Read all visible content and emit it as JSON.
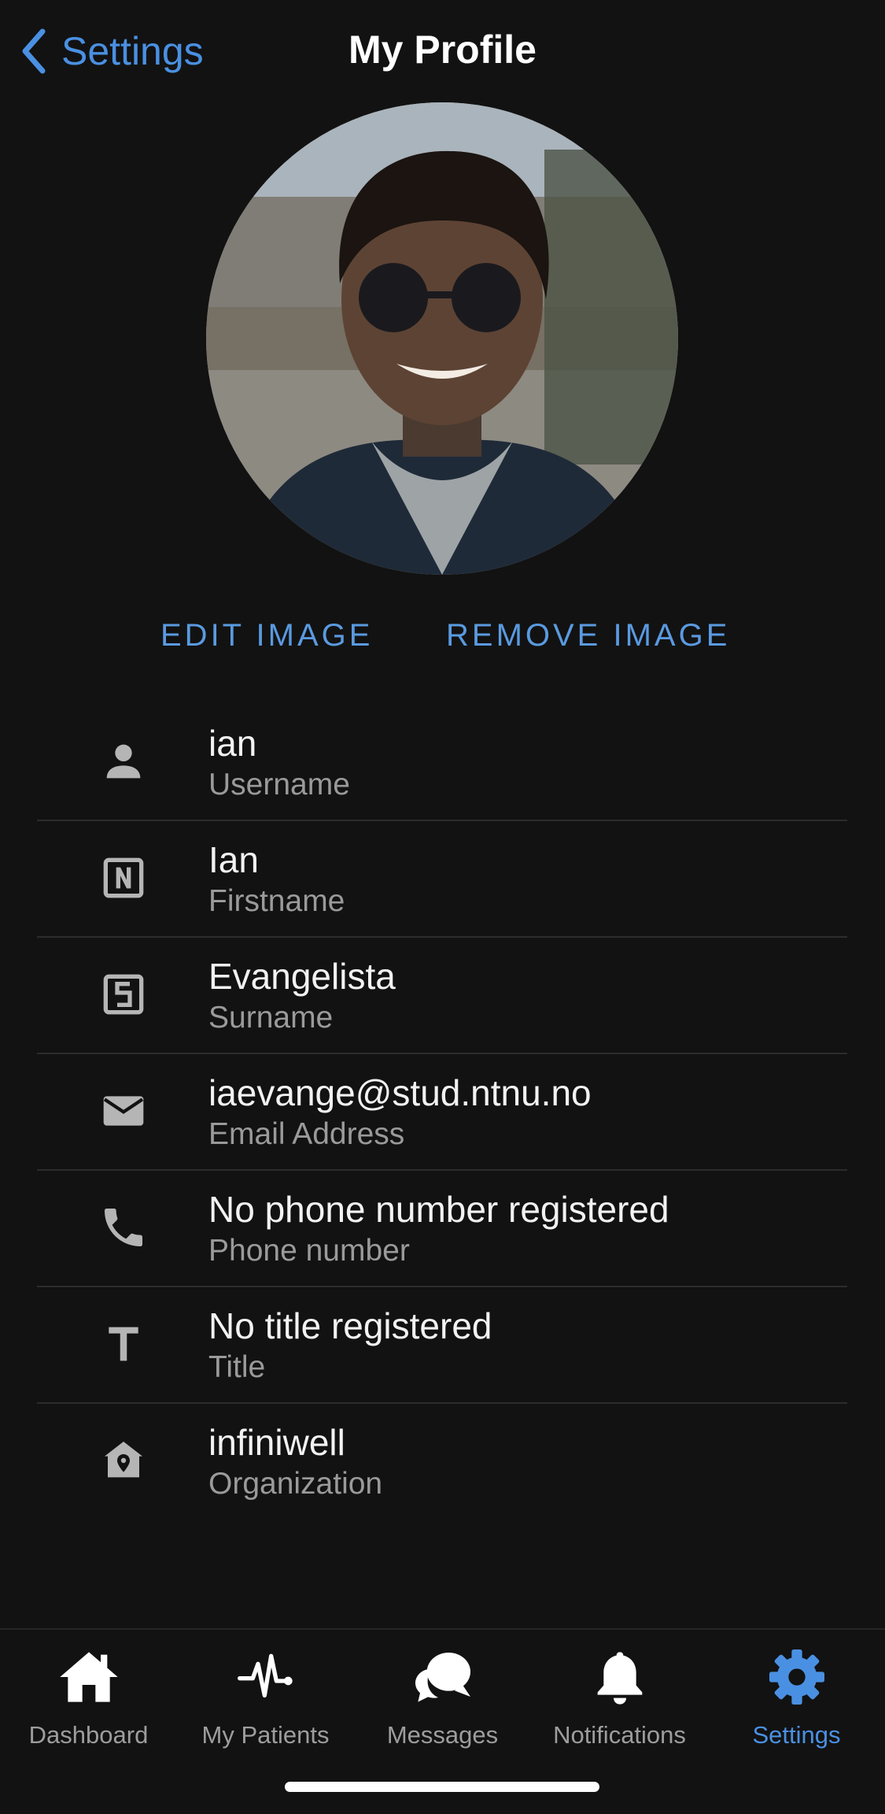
{
  "nav": {
    "back_label": "Settings",
    "title": "My Profile"
  },
  "image_actions": {
    "edit": "EDIT IMAGE",
    "remove": "REMOVE IMAGE"
  },
  "profile": [
    {
      "icon": "person-icon",
      "value": "ian",
      "label": "Username"
    },
    {
      "icon": "firstname-n-icon",
      "value": "Ian",
      "label": "Firstname"
    },
    {
      "icon": "surname-s-icon",
      "value": "Evangelista",
      "label": "Surname"
    },
    {
      "icon": "email-icon",
      "value": "iaevange@stud.ntnu.no",
      "label": "Email Address"
    },
    {
      "icon": "phone-icon",
      "value": "No phone number registered",
      "label": "Phone number"
    },
    {
      "icon": "title-t-icon",
      "value": "No title registered",
      "label": "Title"
    },
    {
      "icon": "organization-icon",
      "value": "infiniwell",
      "label": "Organization"
    }
  ],
  "tabs": [
    {
      "icon": "home-icon",
      "label": "Dashboard",
      "active": false
    },
    {
      "icon": "heartbeat-icon",
      "label": "My Patients",
      "active": false
    },
    {
      "icon": "chat-bubbles-icon",
      "label": "Messages",
      "active": false
    },
    {
      "icon": "bell-icon",
      "label": "Notifications",
      "active": false
    },
    {
      "icon": "gear-icon",
      "label": "Settings",
      "active": true
    }
  ],
  "colors": {
    "background": "#121212",
    "accent": "#4a90e2",
    "text_primary": "#f2f2f2",
    "text_secondary": "#9a9a9a",
    "icon": "#b5b5b5",
    "divider": "#2c2c2e"
  }
}
